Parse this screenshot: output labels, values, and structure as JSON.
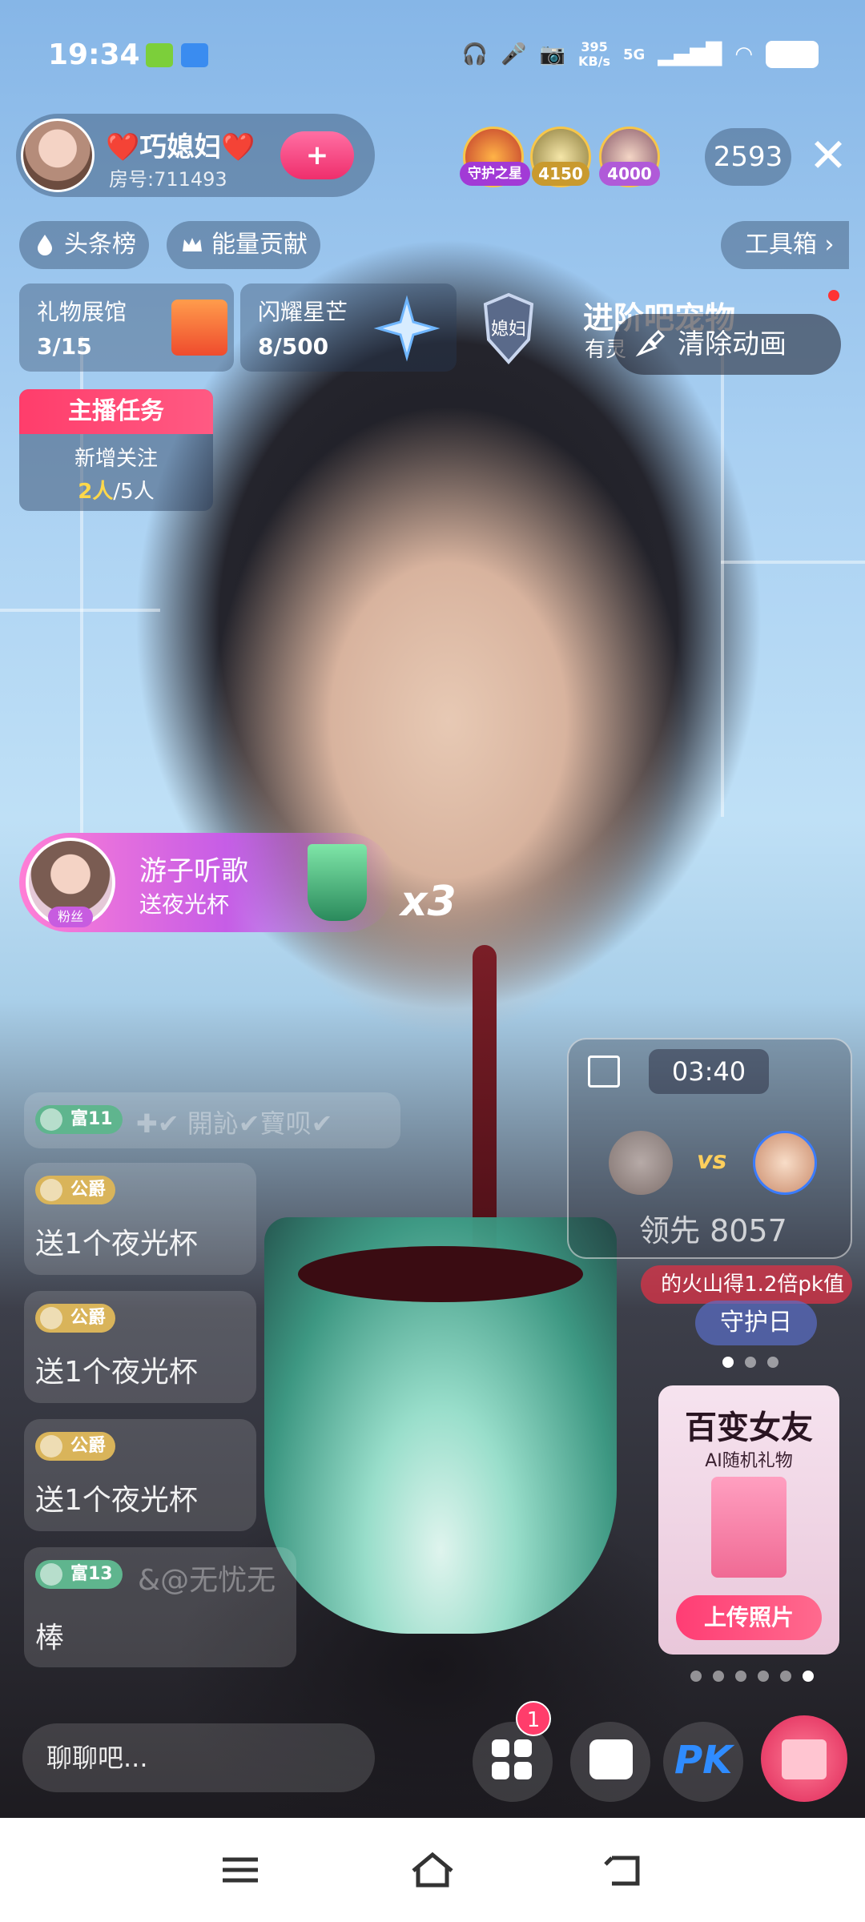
{
  "status_bar": {
    "time": "19:34",
    "net_speed_value": "395",
    "net_speed_unit": "KB/s",
    "network": "5G"
  },
  "anchor": {
    "name": "❤️巧媳妇❤️",
    "room": "房号:711493",
    "follow_label": "+"
  },
  "viewers": {
    "tags": [
      "守护之星",
      "4150",
      "4000"
    ],
    "count": "2593"
  },
  "chips": {
    "headline": "头条榜",
    "energy": "能量贡献",
    "toolbox": "工具箱 ›"
  },
  "panels": {
    "gift_hall_title": "礼物展馆",
    "gift_hall_value": "3/15",
    "star_title": "闪耀星芒",
    "star_value": "8/500",
    "shield_text": "媳妇",
    "pet_title": "进阶吧宠物",
    "pet_sub": "有灵",
    "clear_anim": "清除动画"
  },
  "task": {
    "title": "主播任务",
    "line": "新增关注",
    "done": "2人",
    "total": "/5人"
  },
  "gift_banner": {
    "fan_tag": "粉丝",
    "user": "游子听歌",
    "action": "送夜光杯",
    "count": "x3"
  },
  "chat": [
    {
      "level": "富11",
      "text": "✚✔ 開訫✔寶呗✔",
      "dim": true
    },
    {
      "level": "公爵",
      "text": "送1个夜光杯",
      "dim": false
    },
    {
      "level": "公爵",
      "text": "送1个夜光杯",
      "dim": false
    },
    {
      "level": "公爵",
      "text": "送1个夜光杯",
      "dim": false
    },
    {
      "level": "富13",
      "text": "&@无忧无",
      "dim": true,
      "extra": "棒"
    }
  ],
  "pk": {
    "timer": "03:40",
    "vs": "vs",
    "lead": "领先 8057",
    "banner": "的火山得1.2倍pk值",
    "guard_day": "守护日"
  },
  "promo": {
    "title": "百变女友",
    "subtitle": "AI随机礼物",
    "button": "上传照片"
  },
  "bottom": {
    "chat_placeholder": "聊聊吧...",
    "badge": "1",
    "pk_label": "PK"
  },
  "colors": {
    "accent_pink": "#ff3d6b",
    "gold": "#ffd84a",
    "level_fu": "#5fb58e",
    "level_gj": "#d9b45a"
  }
}
